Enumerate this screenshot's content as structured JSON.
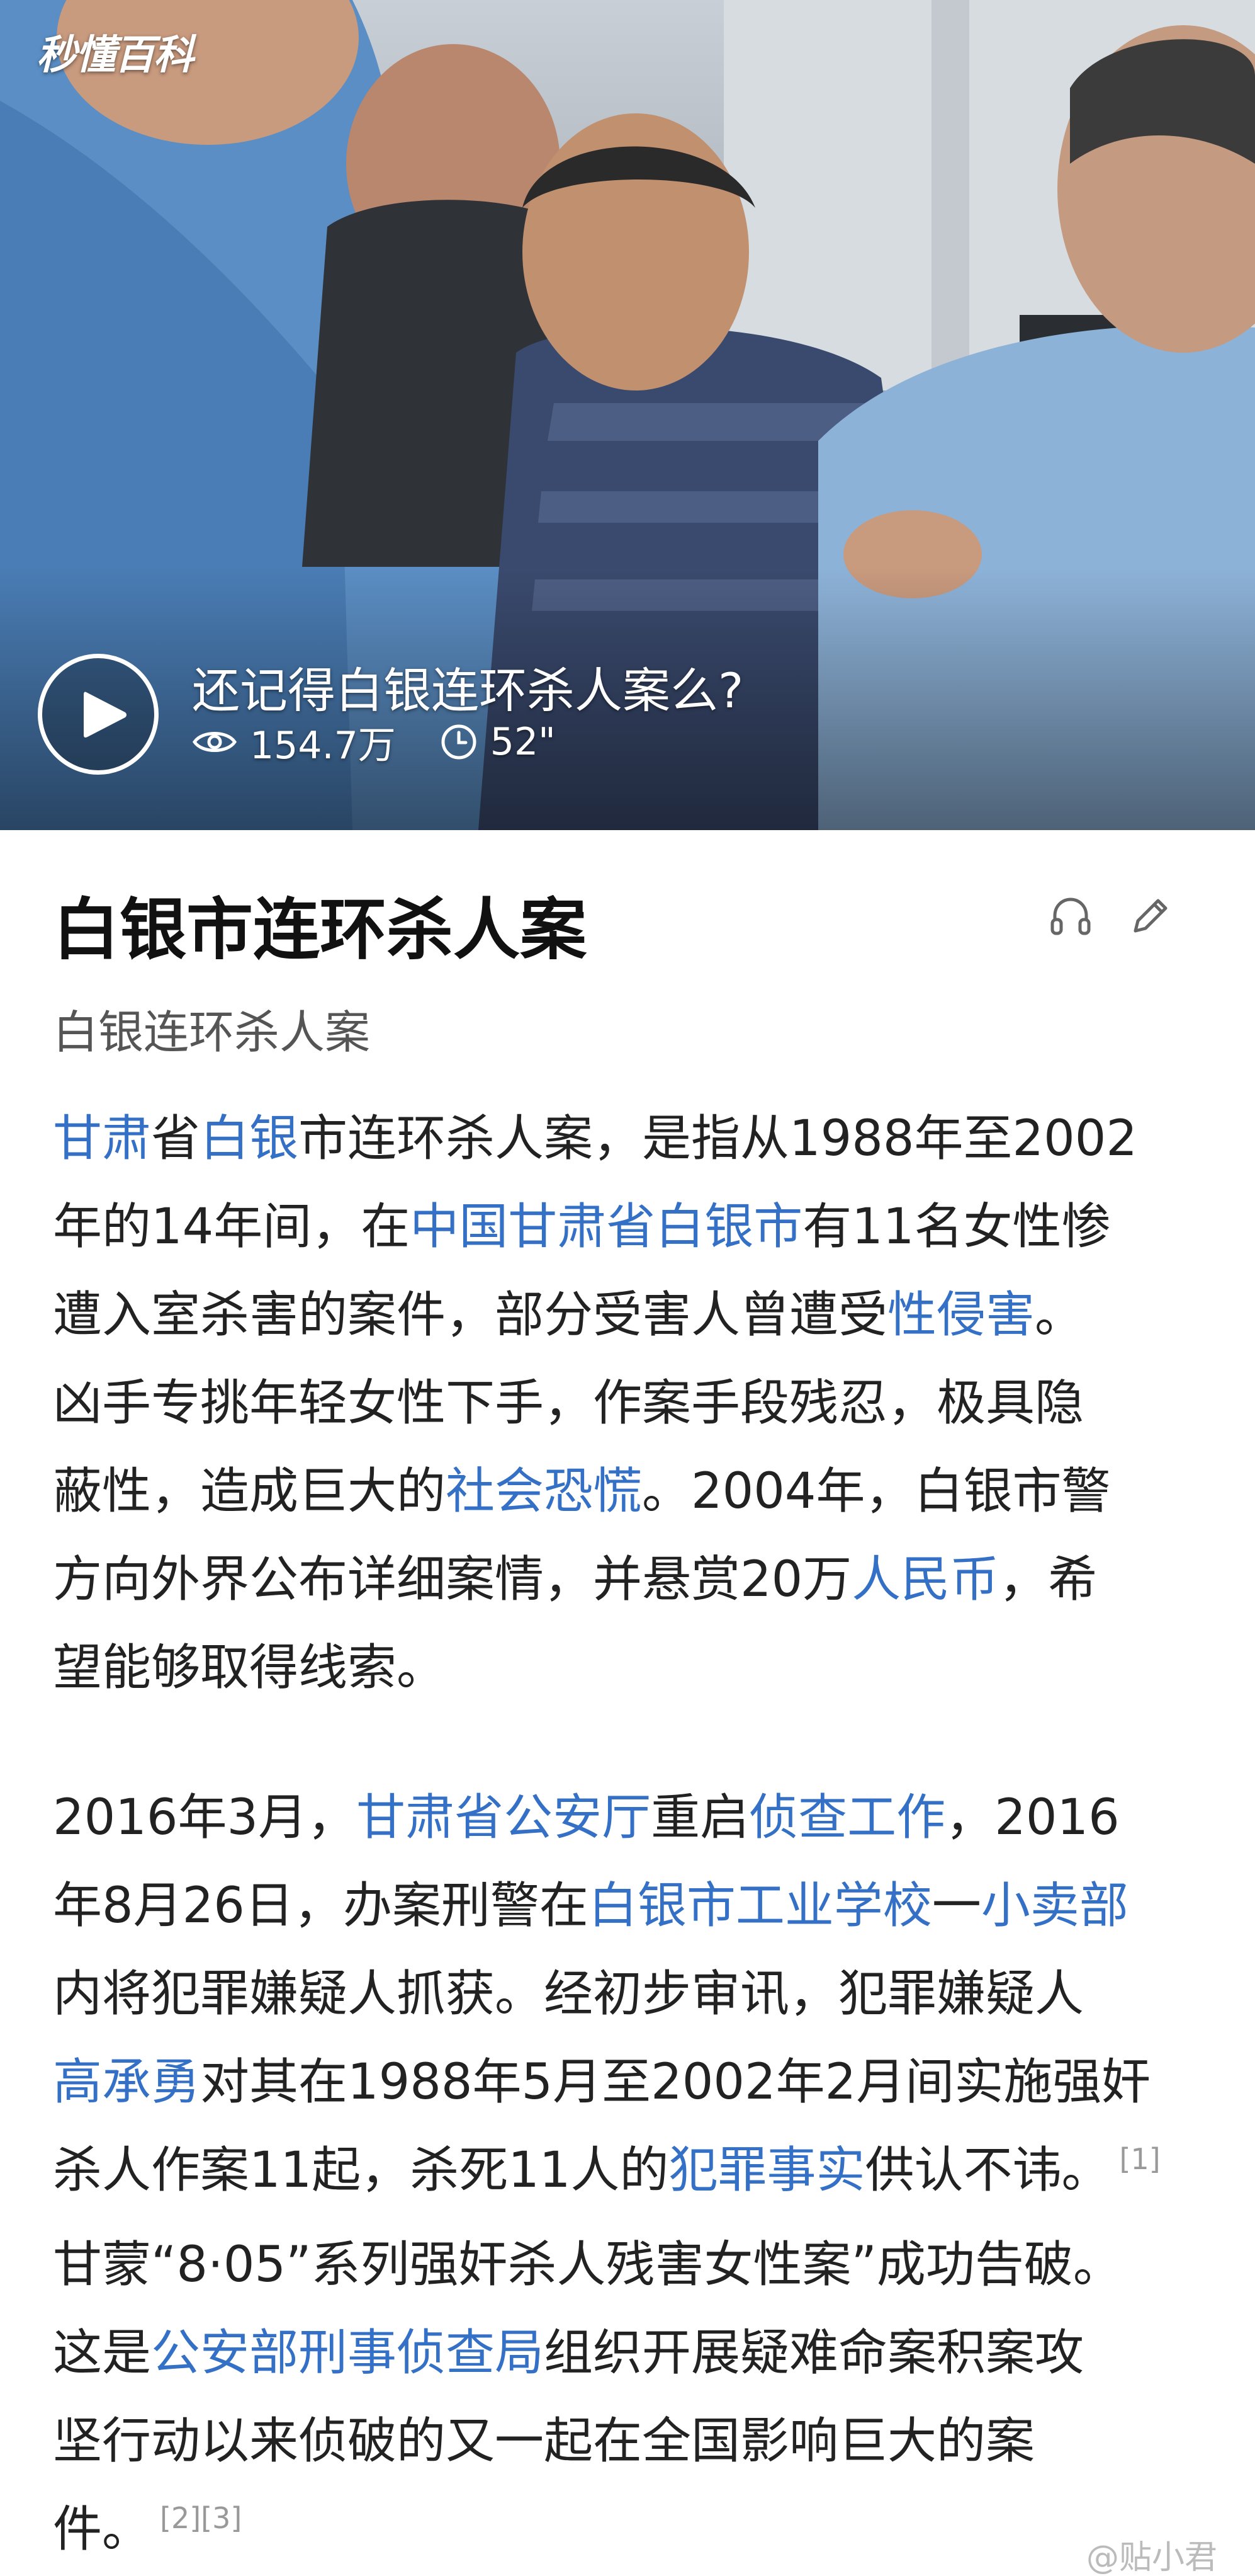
{
  "video": {
    "watermark": "秒懂百科",
    "title": "还记得白银连环杀人案么?",
    "views": "154.7万",
    "duration": "52\"",
    "icons": {
      "play": "play-icon",
      "views": "eye-icon",
      "duration": "clock-icon"
    }
  },
  "entry": {
    "title": "白银市连环杀人案",
    "subtitle": "白银连环杀人案",
    "icons": {
      "listen": "headphones-icon",
      "edit": "pencil-icon"
    }
  },
  "paragraph1": {
    "lines": [
      [
        {
          "t": "甘肃",
          "link": true
        },
        {
          "t": "省"
        },
        {
          "t": "白银",
          "link": true
        },
        {
          "t": "市连环杀人案，是指从1988年至2002"
        }
      ],
      [
        {
          "t": "年的14年间，在"
        },
        {
          "t": "中国甘肃省白银市",
          "link": true
        },
        {
          "t": "有11名女性惨"
        }
      ],
      [
        {
          "t": "遭入室杀害的案件，部分受害人曾遭受"
        },
        {
          "t": "性侵害",
          "link": true
        },
        {
          "t": "。"
        }
      ],
      [
        {
          "t": "凶手专挑年轻女性下手，作案手段残忍，极具隐"
        }
      ],
      [
        {
          "t": "蔽性，造成巨大的"
        },
        {
          "t": "社会恐慌",
          "link": true
        },
        {
          "t": "。2004年，白银市警"
        }
      ],
      [
        {
          "t": "方向外界公布详细案情，并悬赏20万"
        },
        {
          "t": "人民币",
          "link": true
        },
        {
          "t": "，希"
        }
      ],
      [
        {
          "t": "望能够取得线索。"
        }
      ]
    ]
  },
  "paragraph2": {
    "lines": [
      [
        {
          "t": "2016年3月，"
        },
        {
          "t": "甘肃省公安厅",
          "link": true
        },
        {
          "t": "重启"
        },
        {
          "t": "侦查工作",
          "link": true
        },
        {
          "t": "，2016"
        }
      ],
      [
        {
          "t": "年8月26日，办案刑警在"
        },
        {
          "t": "白银市工业学校",
          "link": true
        },
        {
          "t": "一"
        },
        {
          "t": "小卖部",
          "link": true
        }
      ],
      [
        {
          "t": "内将犯罪嫌疑人抓获。经初步审讯，犯罪嫌疑人"
        }
      ],
      [
        {
          "t": "高承勇",
          "link": true
        },
        {
          "t": "对其在1988年5月至2002年2月间实施强奸"
        }
      ],
      [
        {
          "t": "杀人作案11起，杀死11人的"
        },
        {
          "t": "犯罪事实",
          "link": true
        },
        {
          "t": "供认不讳。"
        },
        {
          "t": "[1]",
          "ref": true
        }
      ],
      [
        {
          "t": "甘蒙“8·05”系列强奸杀人残害女性案”成功告破。"
        }
      ],
      [
        {
          "t": "这是"
        },
        {
          "t": "公安部刑事侦查局",
          "link": true
        },
        {
          "t": "组织开展疑难命案积案攻"
        }
      ],
      [
        {
          "t": "坚行动以来侦破的又一起在全国影响巨大的案"
        }
      ],
      [
        {
          "t": "件。"
        },
        {
          "t": "[2][3]",
          "ref": true
        }
      ]
    ]
  },
  "footer": {
    "weibo_watermark": "@贴小君"
  },
  "colors": {
    "link": "#3370c6",
    "text": "#222222",
    "subtitle": "#555555",
    "ref": "#999999"
  }
}
